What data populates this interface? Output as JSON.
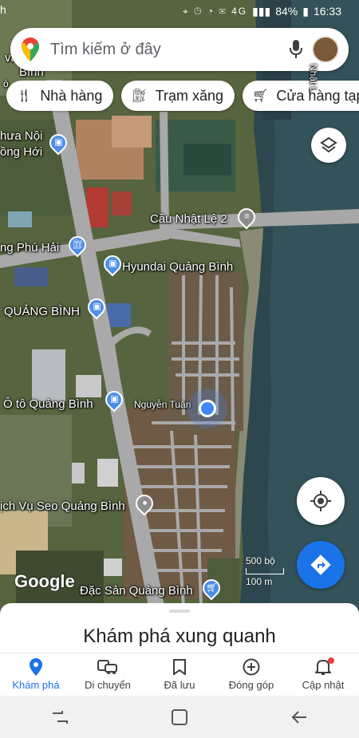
{
  "status_bar": {
    "left_text": "h",
    "icons": "⌖ ◷ ◔ ✉ 4G",
    "battery": "84%",
    "time": "16:33"
  },
  "search": {
    "placeholder": "Tìm kiếm ở đây",
    "icons": [
      "maps-pin-logo",
      "mic-icon",
      "avatar"
    ]
  },
  "chips": [
    {
      "icon": "fork-knife-icon",
      "label": "Nhà hàng"
    },
    {
      "icon": "fuel-icon",
      "label": "Trạm xăng"
    },
    {
      "icon": "cart-icon",
      "label": "Cửa hàng tạp h"
    }
  ],
  "map_labels": {
    "thua_noi": "hưa Nội",
    "dong_hoi": "ồng Hới",
    "cau_nhat_le": "Cầu Nhật Lệ 2",
    "phu_hai": "ng Phú Hải",
    "hyundai": "Hyundai Quảng Bình",
    "quang_binh": "QUẢNG BÌNH",
    "oto": "Ô tô Quảng Bình",
    "nguyen_tuan": "Nguyễn Tuân",
    "seo": "ịch Vụ Seo Quảng Bình",
    "dac_san": "Đặc Sản Quảng Bình",
    "top_left_1": "vă",
    "top_left_2": "Bình",
    "top_left_3": "ò",
    "vertical_right": "Nhật L"
  },
  "scale": {
    "top": "500 bộ",
    "bottom": "100 m"
  },
  "google_logo": "Google",
  "sheet": {
    "title": "Khám phá xung quanh"
  },
  "tabs": [
    {
      "label": "Khám phá",
      "icon": "location-pin-icon",
      "active": true
    },
    {
      "label": "Di chuyển",
      "icon": "commute-icon",
      "active": false
    },
    {
      "label": "Đã lưu",
      "icon": "bookmark-icon",
      "active": false
    },
    {
      "label": "Đóng góp",
      "icon": "add-circle-icon",
      "active": false
    },
    {
      "label": "Cập nhật",
      "icon": "bell-icon",
      "active": false
    }
  ],
  "colors": {
    "accent": "#1a73e8",
    "water": "#2f4a52",
    "notification": "#ea4335"
  }
}
